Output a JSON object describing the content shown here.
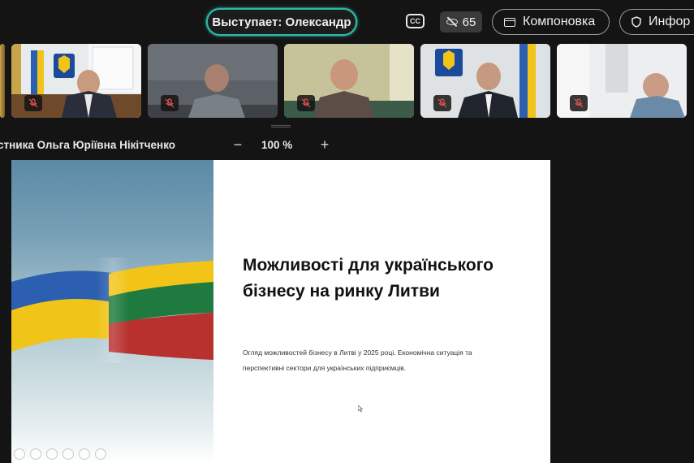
{
  "topbar": {
    "speaker_label": "Выступает: Олександр",
    "cc_label": "CC",
    "viewer_count": "65",
    "layout_label": "Компоновка",
    "info_label": "Инфор"
  },
  "participants": [
    {
      "name_hint": "participant-1",
      "muted": true
    },
    {
      "name_hint": "participant-2",
      "muted": true
    },
    {
      "name_hint": "participant-3",
      "muted": true
    },
    {
      "name_hint": "participant-4",
      "muted": true
    },
    {
      "name_hint": "participant-5",
      "muted": true
    }
  ],
  "share": {
    "sharer_label": "стника Ольга Юріївна Нікітченко",
    "zoom_minus": "−",
    "zoom_value": "100 %",
    "zoom_plus": "+"
  },
  "slide": {
    "title": "Можливості для українського бізнесу на ринку Литви",
    "subtitle": "Огляд можливостей бізнесу в Литві у 2025 році. Економічна ситуація та перспективні сектори для українських підприємців."
  },
  "colors": {
    "speaker_ring": "#2fb8a6",
    "ua_blue": "#2d5fb0",
    "ua_yellow": "#f0c419",
    "lt_yellow": "#f2c418",
    "lt_green": "#1e7a3e",
    "lt_red": "#b8312f"
  }
}
